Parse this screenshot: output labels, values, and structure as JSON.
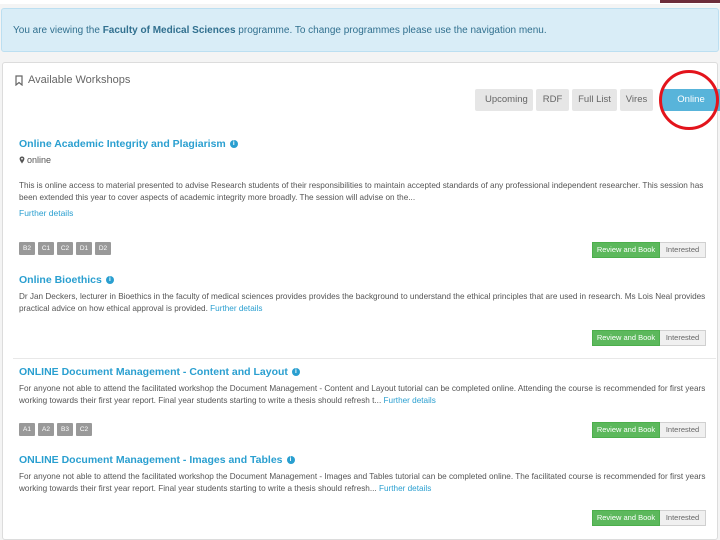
{
  "notice": {
    "prefix": "You are viewing the ",
    "faculty": "Faculty of Medical Sciences",
    "suffix": " programme. To change programmes please use the navigation menu."
  },
  "panel": {
    "heading": "Available Workshops",
    "tabs": [
      {
        "label": "Upcoming",
        "active": false
      },
      {
        "label": "RDF",
        "active": false
      },
      {
        "label": "Full List",
        "active": false
      },
      {
        "label": "Vires",
        "active": false
      },
      {
        "label": "Online",
        "active": true
      }
    ]
  },
  "annotation": {
    "color": "#e3141c"
  },
  "workshops": [
    {
      "title": "Online Academic Integrity and Plagiarism",
      "location": "online",
      "description": "This is online access to material presented to advise Research students of their responsibilities to maintain accepted standards of any professional independent researcher. This session has been extended this year to cover aspects of academic integrity more broadly. The session will advise on the...",
      "link": "Further details",
      "badges": [
        "B2",
        "C1",
        "C2",
        "D1",
        "D2"
      ],
      "book_label": "Review and Book",
      "interest_label": "Interested"
    },
    {
      "title": "Online Bioethics",
      "description": "Dr Jan Deckers, lecturer in Bioethics in the faculty of medical sciences provides provides the background to understand the ethical principles that are used in research. Ms Lois Neal provides practical advice on how ethical approval is provided.",
      "link": "Further details",
      "book_label": "Review and Book",
      "interest_label": "Interested"
    },
    {
      "title": "ONLINE Document Management - Content and Layout",
      "description": "For anyone not able to attend the facilitated workshop the Document Management - Content and Layout tutorial can be completed online. Attending the course is recommended for first years working towards their first year report. Final year students starting to write a thesis should refresh t...",
      "link": "Further details",
      "badges": [
        "A1",
        "A2",
        "B3",
        "C2"
      ],
      "book_label": "Review and Book",
      "interest_label": "Interested"
    },
    {
      "title": "ONLINE Document Management - Images and Tables",
      "description": "For anyone not able to attend the facilitated workshop the Document Management - Images and Tables tutorial can be completed online. The facilitated course is recommended for first years working towards their first year report. Final year students starting to write a thesis should refresh...",
      "link": "Further details",
      "book_label": "Review and Book",
      "interest_label": "Interested"
    }
  ]
}
